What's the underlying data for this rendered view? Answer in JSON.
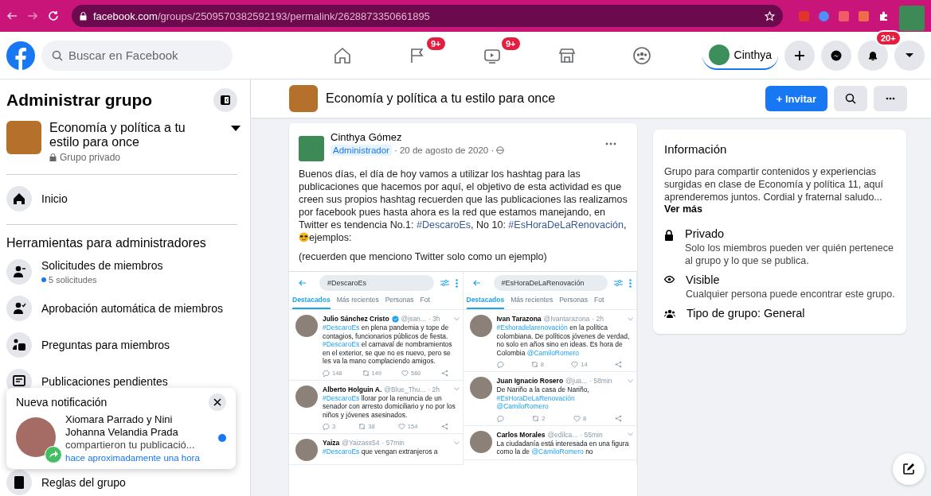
{
  "browser": {
    "url_host": "facebook.com",
    "url_path": "/groups/2509570382592193/permalink/2628873350661895"
  },
  "header": {
    "search": {
      "placeholder": "Buscar en Facebook"
    },
    "nav": [
      {
        "kind": "home"
      },
      {
        "kind": "flag",
        "badge": "9+"
      },
      {
        "kind": "video",
        "badge": "9+"
      },
      {
        "kind": "store"
      },
      {
        "kind": "groups"
      }
    ],
    "profile": {
      "name": "Cinthya"
    },
    "actions": [
      {
        "kind": "plus"
      },
      {
        "kind": "messenger"
      },
      {
        "kind": "bell",
        "badge": "20+"
      },
      {
        "kind": "caret"
      }
    ]
  },
  "sidebar": {
    "title": "Administrar grupo",
    "group": {
      "name": "Economía y política a tu estilo para once",
      "privacy": "Grupo privado"
    },
    "home": {
      "label": "Inicio"
    },
    "section_title": "Herramientas para administradores",
    "items": [
      {
        "kind": "requests",
        "label": "Solicitudes de miembros",
        "sub": "5 solicitudes"
      },
      {
        "kind": "auto",
        "label": "Aprobación automática de miembros"
      },
      {
        "kind": "questions",
        "label": "Preguntas para miembros"
      },
      {
        "kind": "pending",
        "label": "Publicaciones pendientes"
      }
    ],
    "last_item": {
      "kind": "rules",
      "label": "Reglas del grupo"
    }
  },
  "group_bar": {
    "title": "Economía y política a tu estilo para once",
    "buttons": [
      {
        "kind": "invite",
        "label": "+ Invitar"
      },
      {
        "kind": "search"
      },
      {
        "kind": "more"
      }
    ]
  },
  "post": {
    "author": "Cinthya Gómez",
    "role": "Administrador",
    "date": "· 20 de agosto de 2020 ·",
    "paragraphs": [
      [
        {
          "kind": "text",
          "text": "Buenos días, el día de hoy vamos a utilizar los hashtag para las publicaciones que hacemos por aquí, el objetivo de esta actividad es que creen sus propios hashtag recuerden que las publicaciones las realizamos por facebook pues hasta ahora es la red que estamos manejando, en Twitter es tendencia No.1: "
        },
        {
          "kind": "hashtag",
          "text": "#DescaroEs"
        },
        {
          "kind": "text",
          "text": ", No 10: "
        },
        {
          "kind": "hashtag",
          "text": "#EsHoraDeLaRenovación"
        },
        {
          "kind": "text",
          "text": ", "
        },
        {
          "kind": "emoji"
        },
        {
          "kind": "text",
          "text": "ejemplos:"
        }
      ],
      [
        {
          "kind": "text",
          "text": "(recuerden que menciono Twitter solo como un ejemplo)"
        }
      ]
    ],
    "screens": [
      {
        "search": "#DescaroEs",
        "tabs": [
          {
            "label": "Destacados",
            "selected": true
          },
          {
            "label": "Más recientes",
            "selected": false
          },
          {
            "label": "Personas",
            "selected": false
          },
          {
            "label": "Fot",
            "selected": false
          }
        ],
        "tweets": [
          {
            "name": "Julio Sánchez Cristo",
            "verified": true,
            "handle": "@jsan...",
            "time": "· 3h",
            "body": [
              {
                "kind": "hashtag",
                "text": "#DescaroEs"
              },
              {
                "kind": "text",
                "text": " en plena pandemia y tope de contagios, funcionarios públicos de fiesta. "
              },
              {
                "kind": "hashtag",
                "text": "#DescaroEs"
              },
              {
                "kind": "text",
                "text": " el carnaval de nombramientos en el exterior, se que no es nuevo, pero se les va la mano complaciendo amigos."
              }
            ],
            "stats": [
              {
                "kind": "reply",
                "count": "148"
              },
              {
                "kind": "retweet",
                "count": "149"
              },
              {
                "kind": "like",
                "count": "560"
              },
              {
                "kind": "share"
              }
            ]
          },
          {
            "name": "Alberto Holguin A.",
            "verified": false,
            "handle": "@Blue_Thu...",
            "time": "· 2h",
            "body": [
              {
                "kind": "hashtag",
                "text": "#DescaroEs"
              },
              {
                "kind": "text",
                "text": " llorar por la renuncia de un senador con arresto domiciliario y no por los niños y jóvenes asesinados."
              }
            ],
            "stats": [
              {
                "kind": "reply",
                "count": "3"
              },
              {
                "kind": "retweet",
                "count": "38"
              },
              {
                "kind": "like",
                "count": "154"
              },
              {
                "kind": "share"
              }
            ]
          },
          {
            "name": "Yaiza",
            "verified": false,
            "handle": "@Yaizass54",
            "time": "· 57min",
            "body": [
              {
                "kind": "hashtag",
                "text": "#DescaroEs"
              },
              {
                "kind": "text",
                "text": " que vengan extranjeros a"
              }
            ]
          }
        ]
      },
      {
        "search": "#EsHoraDeLaRenovación",
        "tabs": [
          {
            "label": "Destacados",
            "selected": true
          },
          {
            "label": "Más recientes",
            "selected": false
          },
          {
            "label": "Personas",
            "selected": false
          },
          {
            "label": "Fot",
            "selected": false
          }
        ],
        "tweets": [
          {
            "name": "Ivan Tarazona",
            "verified": false,
            "handle": "@Ivantarazona",
            "time": "· 2h",
            "body": [
              {
                "kind": "hashtag",
                "text": "#Eshoradelarenovación"
              },
              {
                "kind": "text",
                "text": " en la política colombiana. De políticos jóvenes de verdad, no solo en años sino en ideas. Es hora de Colombia "
              },
              {
                "kind": "mention",
                "text": "@CamiloRomero"
              }
            ],
            "stats": [
              {
                "kind": "reply"
              },
              {
                "kind": "retweet",
                "count": "8"
              },
              {
                "kind": "like",
                "count": "14"
              },
              {
                "kind": "share"
              }
            ]
          },
          {
            "name": "Juan Ignacio Rosero",
            "verified": false,
            "handle": "@jua...",
            "time": "· 58min",
            "body": [
              {
                "kind": "text",
                "text": "De Nariño a la casa de Nariño,"
              },
              {
                "kind": "break"
              },
              {
                "kind": "hashtag",
                "text": "#EsHoraDeLaRenovación"
              },
              {
                "kind": "break"
              },
              {
                "kind": "mention",
                "text": "@CamiloRomero"
              }
            ],
            "stats": [
              {
                "kind": "reply"
              },
              {
                "kind": "retweet",
                "count": "2"
              },
              {
                "kind": "like",
                "count": "8"
              },
              {
                "kind": "share"
              }
            ]
          },
          {
            "name": "Carlos Morales",
            "verified": false,
            "handle": "@edilca...",
            "time": "· 55min",
            "body": [
              {
                "kind": "text",
                "text": "La ciudadanía está interesada en una figura como la de "
              },
              {
                "kind": "mention",
                "text": "@CamiloRomero"
              },
              {
                "kind": "text",
                "text": " no"
              }
            ]
          }
        ]
      }
    ]
  },
  "info": {
    "title": "Información",
    "description": "Grupo para compartir contenidos y experiencias surgidas en clase de Economía y política 11, aquí aprenderemos juntos. Cordial y fraternal saludo...",
    "more": "Ver más",
    "rows": [
      {
        "kind": "lock",
        "title": "Privado",
        "text": "Solo los miembros pueden ver quién pertenece al grupo y lo que se publica."
      },
      {
        "kind": "eye",
        "title": "Visible",
        "text": "Cualquier persona puede encontrar este grupo."
      },
      {
        "kind": "people",
        "title": "Tipo de grupo: General"
      }
    ]
  },
  "notification": {
    "title": "Nueva notificación",
    "names": "Xiomara Parrado y Nini Johanna Velandia Prada",
    "action": "compartieron tu publicació...",
    "time": "hace aproximadamente una hora",
    "unread": true
  }
}
